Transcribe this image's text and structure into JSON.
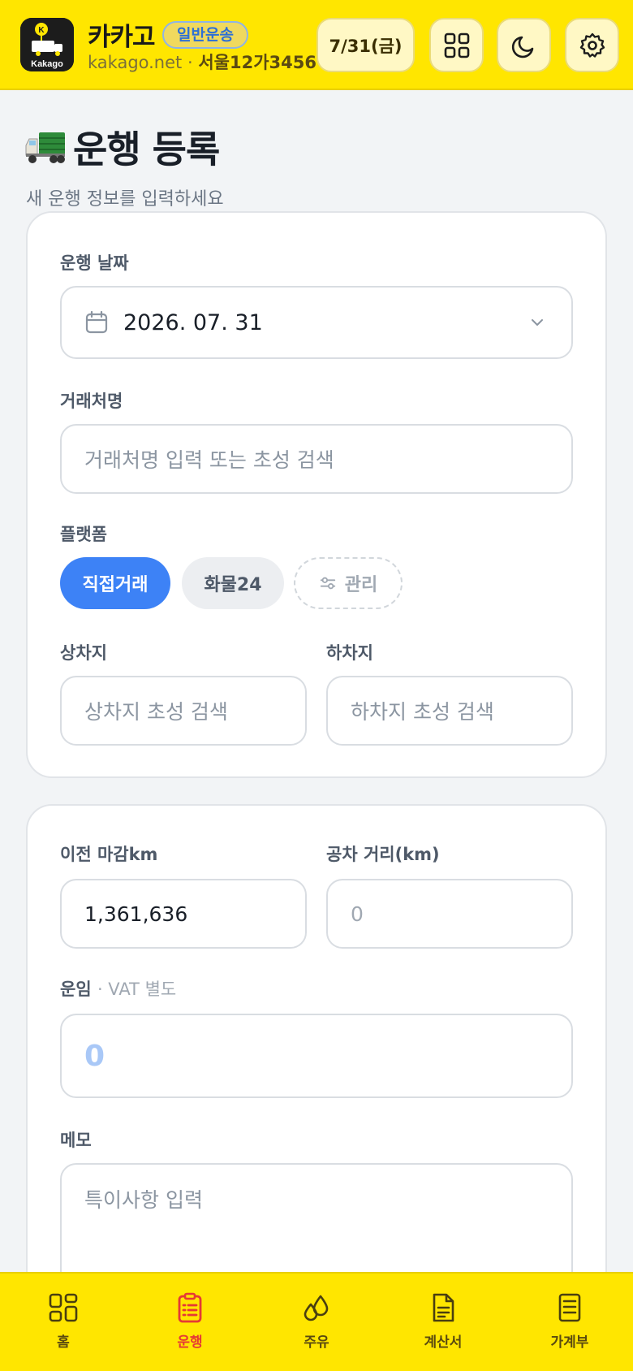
{
  "header": {
    "logo_text": "Kakago",
    "brand_name": "카카고",
    "badge": "일반운송",
    "site": "kakago.net",
    "separator": "·",
    "plate": "서울12가3456",
    "date_button": "7/31(금)",
    "icons": [
      "grid-icon",
      "moon-icon",
      "gear-icon"
    ]
  },
  "page": {
    "title": "운행 등록",
    "subtitle": "새 운행 정보를 입력하세요"
  },
  "form1": {
    "date_label": "운행 날짜",
    "date_value": "2026. 07. 31",
    "client_label": "거래처명",
    "client_placeholder": "거래처명 입력 또는 초성 검색",
    "platform_label": "플랫폼",
    "platforms": [
      {
        "label": "직접거래",
        "selected": true
      },
      {
        "label": "화물24",
        "selected": false
      }
    ],
    "manage_label": "관리",
    "pickup_label": "상차지",
    "pickup_placeholder": "상차지 초성 검색",
    "dropoff_label": "하차지",
    "dropoff_placeholder": "하차지 초성 검색"
  },
  "form2": {
    "prev_km_label": "이전 마감km",
    "prev_km_value": "1,361,636",
    "empty_km_label": "공차 거리(km)",
    "empty_km_placeholder": "0",
    "fare_label": "운임",
    "fare_note": "· VAT 별도",
    "fare_placeholder": "0",
    "memo_label": "메모",
    "memo_placeholder": "특이사항 입력"
  },
  "nav": {
    "items": [
      {
        "label": "홈",
        "icon": "home-grid-icon",
        "active": false
      },
      {
        "label": "운행",
        "icon": "clipboard-icon",
        "active": true
      },
      {
        "label": "주유",
        "icon": "fuel-drop-icon",
        "active": false
      },
      {
        "label": "계산서",
        "icon": "document-icon",
        "active": false
      },
      {
        "label": "가계부",
        "icon": "ledger-icon",
        "active": false
      }
    ]
  },
  "colors": {
    "accent_yellow": "#ffe600",
    "primary_blue": "#3d82f6",
    "active_red": "#e53935"
  }
}
